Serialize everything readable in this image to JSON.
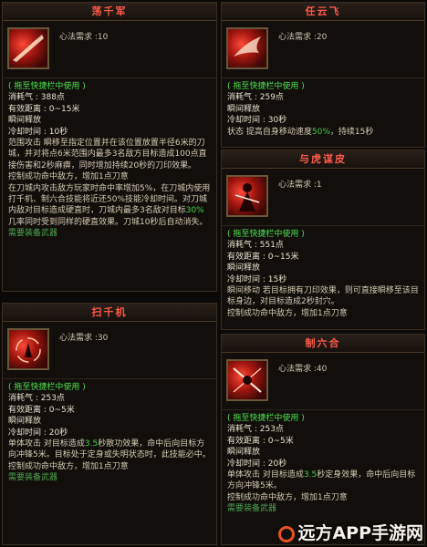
{
  "cards": [
    {
      "title": "荡千军",
      "req": "心法需求 :10",
      "shortcut": "( 拖至快捷栏中使用 )",
      "lines": [
        "消耗气 : 388点",
        "有效距离 : 0~15米",
        "瞬间释放",
        "冷却时间 : 10秒"
      ],
      "desc1": "范围攻击  瞬移至指定位置并在该位置放置半径6米的刀城，并对将点6米范围内最多3名敌方目标造成100点直接伤害和2秒麻痹，同时增加持续20秒的刀印效果。",
      "desc2": "控制成功命中敌方，增加1点刀意",
      "desc3a": "在刀城内攻击敌方玩家时命中率增加5%，在刀城内使用打千机、制六合技能将近还50%技能冷却时间。对刀城内敌对目标造成硬直时，刀城内最多3名敌对目标",
      "desc3hl": "30%",
      "desc3b": "几率同时受到同样的硬直效果。刀城10秒后自动消失。",
      "weapon": "需要装备武器"
    },
    {
      "title": "任云飞",
      "req": "心法需求 :20",
      "shortcut": "( 拖至快捷栏中使用 )",
      "lines": [
        "消耗气 : 259点",
        "瞬间释放",
        "冷却时间 : 30秒"
      ],
      "stat_a": "状态  提高自身移动速度",
      "stat_hl": "50%",
      "stat_b": "，持续15秒"
    },
    {
      "title": "与虎谋皮",
      "req": "心法需求 :1",
      "shortcut": "( 拖至快捷栏中使用 )",
      "lines": [
        "消耗气 : 551点",
        "有效距离 : 0~15米",
        "瞬间释放",
        "冷却时间 : 15秒"
      ],
      "desc1": "瞬间移动  若目标拥有刀印效果，则可直接瞬移至该目标身边，对目标造成2秒封穴。",
      "desc2": "控制成功命中敌方，增加1点刀意"
    },
    {
      "title": "扫千机",
      "req": "心法需求 :30",
      "shortcut": "( 拖至快捷栏中使用 )",
      "lines": [
        "消耗气 : 253点",
        "有效距离 : 0~5米",
        "瞬间释放",
        "冷却时间 : 20秒"
      ],
      "desc1a": "单体攻击  对目标造成",
      "desc1hl": "3.5",
      "desc1b": "秒散功效果，命中后向目标方向冲锋5米。目标处于定身或失明状态时，此技能必中。",
      "desc2": "控制成功命中敌方，增加1点刀意",
      "weapon": "需要装备武器"
    },
    {
      "title": "制六合",
      "req": "心法需求 :40",
      "shortcut": "( 拖至快捷栏中使用 )",
      "lines": [
        "消耗气 : 253点",
        "有效距离 : 0~5米",
        "瞬间释放",
        "冷却时间 : 20秒"
      ],
      "desc1a": "单体攻击  对目标造成",
      "desc1hl": "3.5",
      "desc1b": "秒定身效果，命中后向目标方向冲锋5米。",
      "desc2": "控制成功命中敌方，增加1点刀意",
      "weapon": "需要装备武器"
    }
  ],
  "watermark": "远方APP手游网",
  "colors": {
    "title": "#ff5a4a",
    "green": "#4fe04f",
    "weapon": "#4fa44f",
    "border": "#3a2e22"
  }
}
